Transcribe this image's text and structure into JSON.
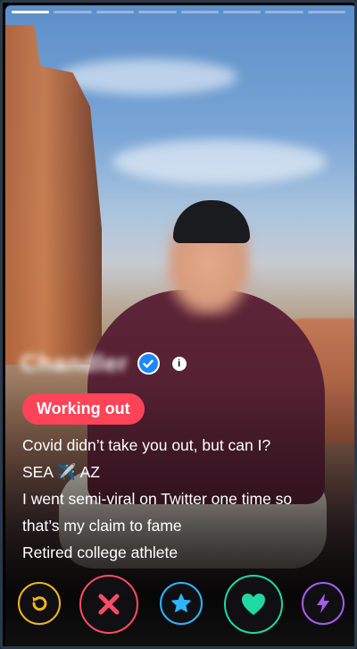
{
  "profile": {
    "name": "Chandler",
    "name_blurred": true,
    "tag": "Working out",
    "bio_lines": [
      "Covid didn’t take you out, but can I?",
      "SEA ✈️ AZ",
      "I went semi-viral on Twitter one time so",
      "that’s my claim to fame",
      "Retired college athlete"
    ],
    "verified": true,
    "photo_count": 8,
    "current_photo": 1
  },
  "icons": {
    "verified": "verified-check-icon",
    "info": "info-icon",
    "rewind": "rewind-icon",
    "nope": "x-icon",
    "superlike": "star-icon",
    "like": "heart-icon",
    "boost": "lightning-bolt-icon"
  },
  "info_label": "i",
  "colors": {
    "tag_bg": "#ff4458",
    "rewind": "#f0b323",
    "nope": "#fd4b63",
    "superlike": "#2db5fc",
    "like": "#1ed9a2",
    "boost": "#a75cf0",
    "verified": "#1e86ff"
  }
}
